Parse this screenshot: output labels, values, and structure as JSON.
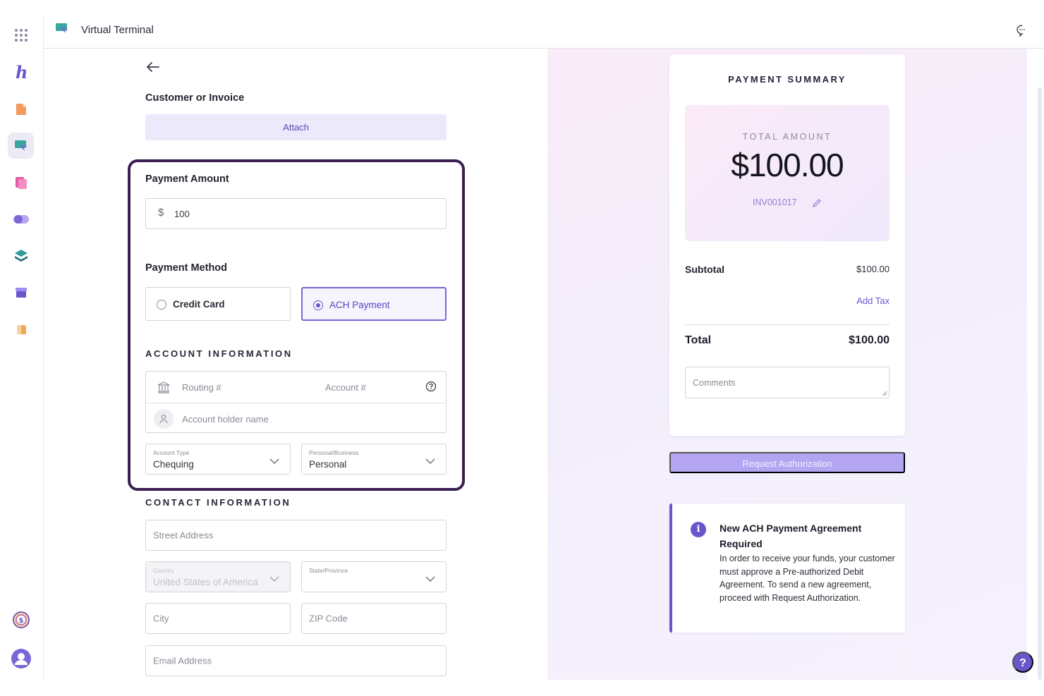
{
  "app": {
    "title": "Virtual Terminal",
    "brand_color": "#6b55cc"
  },
  "rail": {
    "items": [
      {
        "icon": "apps-grid-icon"
      },
      {
        "icon": "h-logo-icon"
      },
      {
        "icon": "document-icon"
      },
      {
        "icon": "virtual-terminal-icon",
        "active": true
      },
      {
        "icon": "invoices-icon"
      },
      {
        "icon": "toggle-icon"
      },
      {
        "icon": "layers-icon"
      },
      {
        "icon": "store-icon"
      },
      {
        "icon": "wallet-icon"
      },
      {
        "icon": "coin-icon"
      },
      {
        "icon": "user-avatar-icon"
      }
    ]
  },
  "form": {
    "customer_label": "Customer or Invoice",
    "attach_label": "Attach",
    "payment_amount_label": "Payment Amount",
    "currency_symbol": "$",
    "amount_value": "100",
    "payment_method_label": "Payment Method",
    "methods": [
      {
        "label": "Credit Card",
        "selected": false
      },
      {
        "label": "ACH Payment",
        "selected": true
      }
    ],
    "account_section": "ACCOUNT INFORMATION",
    "routing_placeholder": "Routing #",
    "account_placeholder": "Account #",
    "holder_placeholder": "Account holder name",
    "account_type_label": "Account Type",
    "account_type_value": "Chequing",
    "personal_business_label": "Personal/Business",
    "personal_business_value": "Personal",
    "contact_section": "CONTACT INFORMATION",
    "street_placeholder": "Street Address",
    "country_label": "Country",
    "country_value": "United States of America",
    "state_label": "State/Province",
    "city_placeholder": "City",
    "zip_placeholder": "ZIP Code",
    "email_placeholder": "Email Address"
  },
  "summary": {
    "title": "PAYMENT SUMMARY",
    "total_amount_label": "TOTAL AMOUNT",
    "total_amount_value": "$100.00",
    "invoice_number": "INV001017",
    "subtotal_label": "Subtotal",
    "subtotal_value": "$100.00",
    "add_tax_label": "Add Tax",
    "total_label": "Total",
    "total_value": "$100.00",
    "comments_placeholder": "Comments",
    "request_button": "Request Authorization"
  },
  "notice": {
    "title": "New ACH Payment Agreement Required",
    "body": "In order to receive your funds, your customer must approve a Pre-authorized Debit Agreement. To send a new agreement, proceed with Request Authorization."
  },
  "help": {
    "label": "?"
  }
}
